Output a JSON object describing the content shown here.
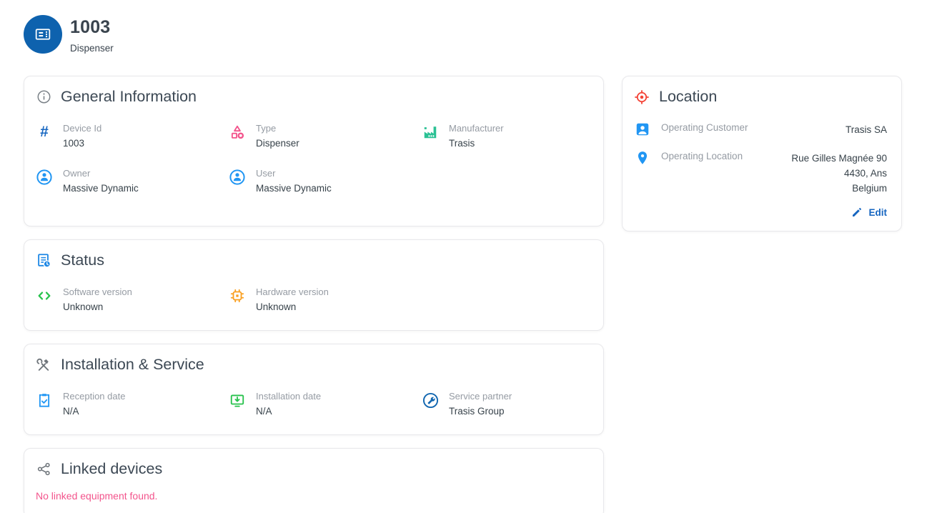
{
  "header": {
    "title": "1003",
    "subtitle": "Dispenser"
  },
  "general": {
    "title": "General Information",
    "fields": [
      {
        "label": "Device Id",
        "value": "1003",
        "icon": "hash-icon"
      },
      {
        "label": "Type",
        "value": "Dispenser",
        "icon": "shapes-icon"
      },
      {
        "label": "Manufacturer",
        "value": "Trasis",
        "icon": "factory-icon"
      },
      {
        "label": "Owner",
        "value": "Massive Dynamic",
        "icon": "person-circle-icon"
      },
      {
        "label": "User",
        "value": "Massive Dynamic",
        "icon": "person-circle-icon"
      }
    ]
  },
  "location": {
    "title": "Location",
    "customer": {
      "label": "Operating Customer",
      "value": "Trasis SA"
    },
    "operating_location": {
      "label": "Operating Location",
      "address_lines": [
        "Rue Gilles Magnée 90",
        "4430, Ans",
        "Belgium"
      ]
    },
    "edit_label": "Edit"
  },
  "status": {
    "title": "Status",
    "fields": [
      {
        "label": "Software version",
        "value": "Unknown",
        "icon": "code-icon"
      },
      {
        "label": "Hardware version",
        "value": "Unknown",
        "icon": "chip-icon"
      }
    ]
  },
  "installation": {
    "title": "Installation & Service",
    "fields": [
      {
        "label": "Reception date",
        "value": "N/A",
        "icon": "clipboard-check-icon"
      },
      {
        "label": "Installation date",
        "value": "N/A",
        "icon": "monitor-download-icon"
      },
      {
        "label": "Service partner",
        "value": "Trasis Group",
        "icon": "wrench-circle-icon"
      }
    ]
  },
  "linked": {
    "title": "Linked devices",
    "empty_message": "No linked equipment found."
  },
  "glyphs": {
    "hash": "#"
  },
  "colors": {
    "avatar_blue": "#0e62ae",
    "icon_blue": "#2196f3",
    "link_blue": "#1565c0",
    "pink": "#f3548c",
    "teal": "#2bc194",
    "green": "#27c24c",
    "amber": "#f9a022",
    "red": "#f44336",
    "icon_gray": "#6f757b",
    "heading_text": "#3c4854",
    "value_text": "#37424a",
    "label_text": "#959ba3"
  }
}
